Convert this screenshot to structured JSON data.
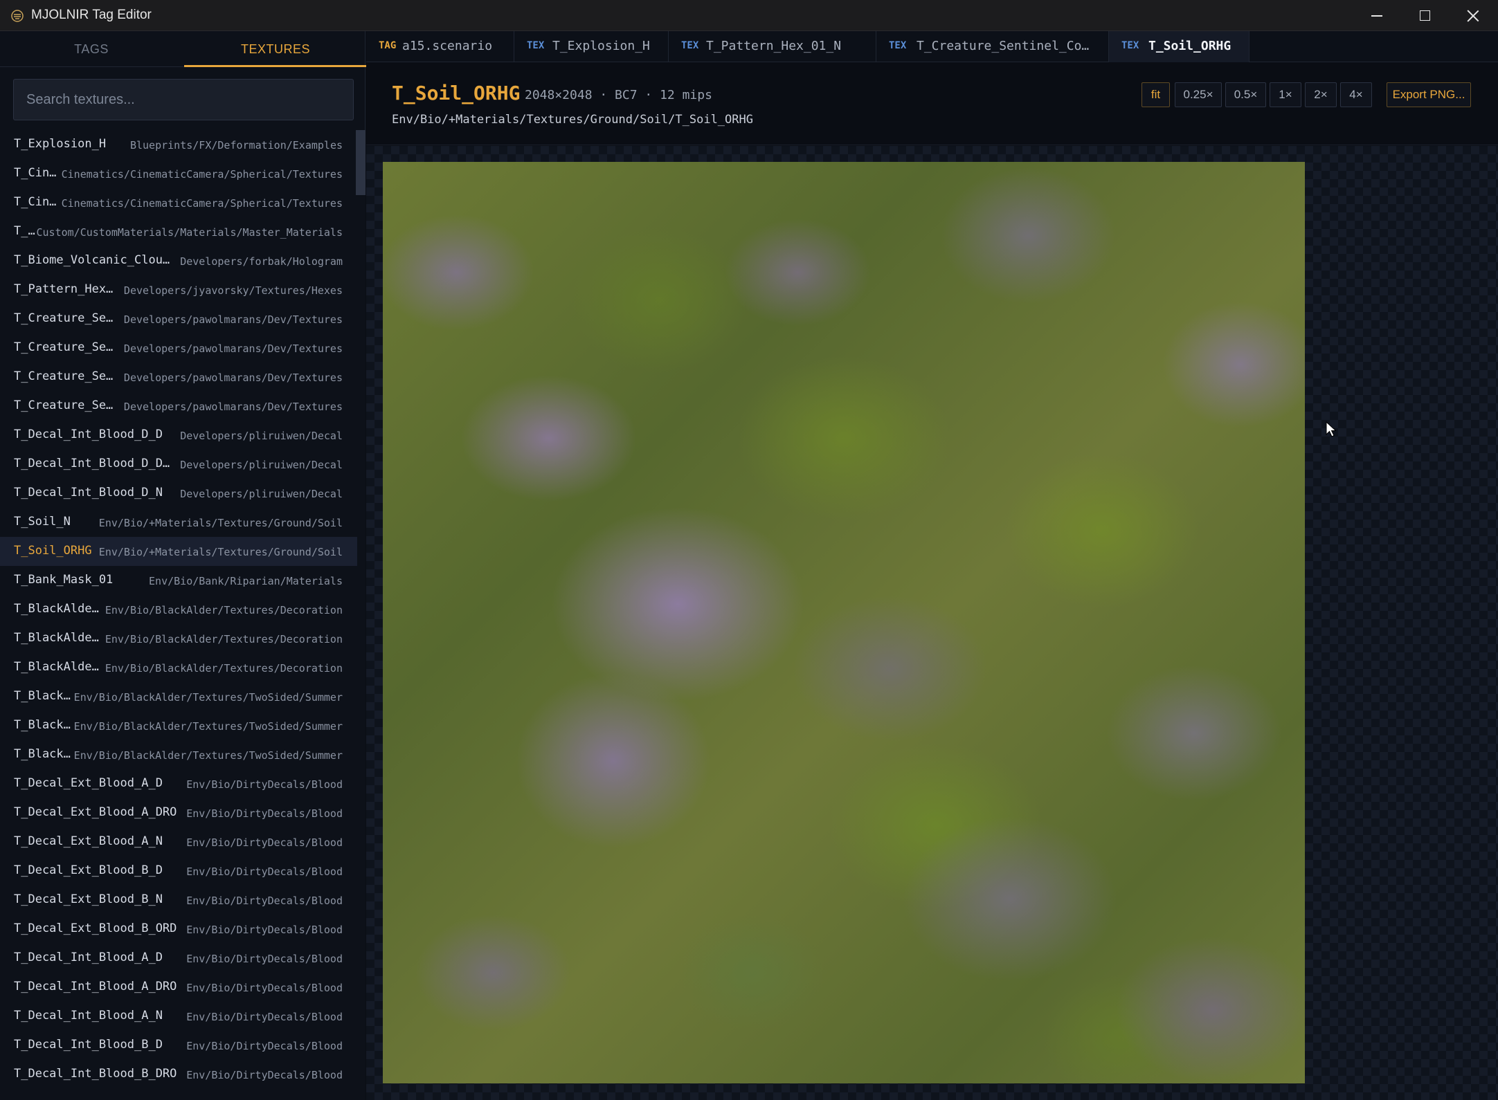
{
  "window": {
    "title": "MJOLNIR Tag Editor"
  },
  "sidebar": {
    "tabs": [
      {
        "label": "TAGS"
      },
      {
        "label": "TEXTURES"
      }
    ],
    "search_placeholder": "Search textures...",
    "items": [
      {
        "name": "T_Explosion_H",
        "path": "Blueprints/FX/Deformation/Examples"
      },
      {
        "name": "T_Cin…",
        "path": "Cinematics/CinematicCamera/Spherical/Textures"
      },
      {
        "name": "T_Cin…",
        "path": "Cinematics/CinematicCamera/Spherical/Textures"
      },
      {
        "name": "T_…",
        "path": "Custom/CustomMaterials/Materials/Master_Materials"
      },
      {
        "name": "T_Biome_Volcanic_Clou…",
        "path": "Developers/forbak/Hologram"
      },
      {
        "name": "T_Pattern_Hex…",
        "path": "Developers/jyavorsky/Textures/Hexes"
      },
      {
        "name": "T_Creature_Se…",
        "path": "Developers/pawolmarans/Dev/Textures"
      },
      {
        "name": "T_Creature_Se…",
        "path": "Developers/pawolmarans/Dev/Textures"
      },
      {
        "name": "T_Creature_Se…",
        "path": "Developers/pawolmarans/Dev/Textures"
      },
      {
        "name": "T_Creature_Se…",
        "path": "Developers/pawolmarans/Dev/Textures"
      },
      {
        "name": "T_Decal_Int_Blood_D_D",
        "path": "Developers/pliruiwen/Decal"
      },
      {
        "name": "T_Decal_Int_Blood_D_D…",
        "path": "Developers/pliruiwen/Decal"
      },
      {
        "name": "T_Decal_Int_Blood_D_N",
        "path": "Developers/pliruiwen/Decal"
      },
      {
        "name": "T_Soil_N",
        "path": "Env/Bio/+Materials/Textures/Ground/Soil"
      },
      {
        "name": "T_Soil_ORHG",
        "path": "Env/Bio/+Materials/Textures/Ground/Soil",
        "selected": true
      },
      {
        "name": "T_Bank_Mask_01",
        "path": "Env/Bio/Bank/Riparian/Materials"
      },
      {
        "name": "T_BlackAlde…",
        "path": "Env/Bio/BlackAlder/Textures/Decoration"
      },
      {
        "name": "T_BlackAlde…",
        "path": "Env/Bio/BlackAlder/Textures/Decoration"
      },
      {
        "name": "T_BlackAlde…",
        "path": "Env/Bio/BlackAlder/Textures/Decoration"
      },
      {
        "name": "T_Black…",
        "path": "Env/Bio/BlackAlder/Textures/TwoSided/Summer"
      },
      {
        "name": "T_Black…",
        "path": "Env/Bio/BlackAlder/Textures/TwoSided/Summer"
      },
      {
        "name": "T_Black…",
        "path": "Env/Bio/BlackAlder/Textures/TwoSided/Summer"
      },
      {
        "name": "T_Decal_Ext_Blood_A_D",
        "path": "Env/Bio/DirtyDecals/Blood"
      },
      {
        "name": "T_Decal_Ext_Blood_A_DRO",
        "path": "Env/Bio/DirtyDecals/Blood"
      },
      {
        "name": "T_Decal_Ext_Blood_A_N",
        "path": "Env/Bio/DirtyDecals/Blood"
      },
      {
        "name": "T_Decal_Ext_Blood_B_D",
        "path": "Env/Bio/DirtyDecals/Blood"
      },
      {
        "name": "T_Decal_Ext_Blood_B_N",
        "path": "Env/Bio/DirtyDecals/Blood"
      },
      {
        "name": "T_Decal_Ext_Blood_B_ORD",
        "path": "Env/Bio/DirtyDecals/Blood"
      },
      {
        "name": "T_Decal_Int_Blood_A_D",
        "path": "Env/Bio/DirtyDecals/Blood"
      },
      {
        "name": "T_Decal_Int_Blood_A_DRO",
        "path": "Env/Bio/DirtyDecals/Blood"
      },
      {
        "name": "T_Decal_Int_Blood_A_N",
        "path": "Env/Bio/DirtyDecals/Blood"
      },
      {
        "name": "T_Decal_Int_Blood_B_D",
        "path": "Env/Bio/DirtyDecals/Blood"
      },
      {
        "name": "T_Decal_Int_Blood_B_DRO",
        "path": "Env/Bio/DirtyDecals/Blood"
      }
    ]
  },
  "doc_tabs": [
    {
      "kind": "TAG",
      "title": "a15.scenario"
    },
    {
      "kind": "TEX",
      "title": "T_Explosion_H"
    },
    {
      "kind": "TEX",
      "title": "T_Pattern_Hex_01_N"
    },
    {
      "kind": "TEX",
      "title": "T_Creature_Sentinel_Co…"
    },
    {
      "kind": "TEX",
      "title": "T_Soil_ORHG"
    }
  ],
  "texture": {
    "name": "T_Soil_ORHG",
    "meta": "2048×2048 · BC7 · 12 mips",
    "path": "Env/Bio/+Materials/Textures/Ground/Soil/T_Soil_ORHG"
  },
  "zoom": {
    "fit": "fit",
    "z025": "0.25×",
    "z05": "0.5×",
    "z1": "1×",
    "z2": "2×",
    "z4": "4×",
    "selected": "fit"
  },
  "export_label": "Export PNG...",
  "colors": {
    "accent": "#e8a73c",
    "tex_badge": "#5b8fd8",
    "background": "#0a0d14"
  },
  "icons": {
    "app": "hammer-icon",
    "cursor": "mouse-cursor-icon"
  }
}
